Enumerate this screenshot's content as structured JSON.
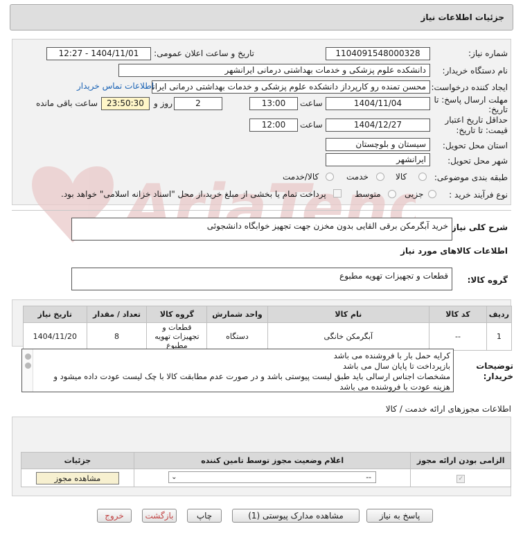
{
  "header": {
    "title": "جزئیات اطلاعات نیاز"
  },
  "form": {
    "need_number_label": "شماره نیاز:",
    "need_number": "1104091548000328",
    "announce_label": "تاریخ و ساعت اعلان عمومی:",
    "announce_value": "1404/11/01 - 12:27",
    "buyer_org_label": "نام دستگاه خریدار:",
    "buyer_org": "دانشکده علوم پزشکی و خدمات بهداشتی درمانی ایرانشهر",
    "creator_label": "ایجاد کننده درخواست:",
    "creator": "محسن تمنده رو کارپرداز دانشکده علوم پزشکی و خدمات بهداشتی درمانی ایرانشهر",
    "contact_link": "اطلاعات تماس خریدار",
    "deadline_label_1": "مهلت ارسال پاسخ: تا",
    "deadline_label_2": "تاریخ:",
    "deadline_date": "1404/11/04",
    "time_label": "ساعت",
    "deadline_time": "13:00",
    "days_value": "2",
    "days_label": "روز و",
    "remaining_value": "23:50:30",
    "remaining_label": "ساعت باقی مانده",
    "validity_label_1": "حداقل تاریخ اعتبار",
    "validity_label_2": "قیمت: تا تاریخ:",
    "validity_date": "1404/12/27",
    "validity_time_label": "ساعت",
    "validity_time": "12:00",
    "province_label": "استان محل تحویل:",
    "province": "سیستان و بلوچستان",
    "city_label": "شهر محل تحویل:",
    "city": "ایرانشهر",
    "category_label": "طبقه بندی موضوعی:",
    "category_options": [
      "کالا",
      "خدمت",
      "کالا/خدمت"
    ],
    "process_label": "نوع فرآیند خرید :",
    "process_options": [
      "جزیی",
      "متوسط"
    ],
    "payment_note": "پرداخت تمام یا بخشی از مبلغ خرید،از محل \"اسناد خزانه اسلامی\" خواهد بود."
  },
  "general_desc": {
    "label": "شرح کلی نیاز:",
    "value": "خرید آبگرمکن برقی القایی بدون مخزن جهت تجهیز خوابگاه دانشجوئی"
  },
  "goods_info": {
    "title": "اطلاعات کالاهای مورد نیاز",
    "group_label": "گروه کالا:",
    "group_value": "قطعات و تجهیزات تهویه مطبوع"
  },
  "items_table": {
    "headers": [
      "ردیف",
      "کد کالا",
      "نام کالا",
      "واحد شمارش",
      "گروه کالا",
      "تعداد / مقدار",
      "تاریخ نیاز"
    ],
    "rows": [
      [
        "1",
        "--",
        "آبگرمکن خانگی",
        "دستگاه",
        "قطعات و تجهیزات تهویه مطبوع",
        "8",
        "1404/11/20"
      ]
    ]
  },
  "buyer_notes": {
    "label_1": "توضیحات",
    "label_2": "خریدار:",
    "lines": [
      "کرایه حمل بار با فروشنده می باشد",
      "بازپرداخت تا پایان سال می باشد",
      "مشخصات اجناس ارسالی باید طبق لیست پیوستی باشد و در صورت عدم مطابقت کالا با چک لیست عودت داده میشود و",
      "هزینه عودت با فروشنده می باشد"
    ]
  },
  "permits": {
    "title": "اطلاعات مجوزهای ارائه خدمت / کالا",
    "headers": [
      "الزامی بودن ارائه مجوز",
      "اعلام وضعیت مجوز توسط تامین کننده",
      "جزئیات"
    ],
    "select_value": "--",
    "view_button": "مشاهده مجوز"
  },
  "buttons": {
    "respond": "پاسخ به نیاز",
    "attachments": "مشاهده مدارک پیوستی (1)",
    "print": "چاپ",
    "back": "بازگشت",
    "exit": "خروج"
  },
  "colors": {
    "header_bg": "#dedede",
    "panel_bg": "#f2f2f2",
    "remaining_bg": "#fff6c8",
    "view_button_bg": "#f7f0d0",
    "link": "#1a63b5",
    "watermark": "#e9c9c9"
  }
}
